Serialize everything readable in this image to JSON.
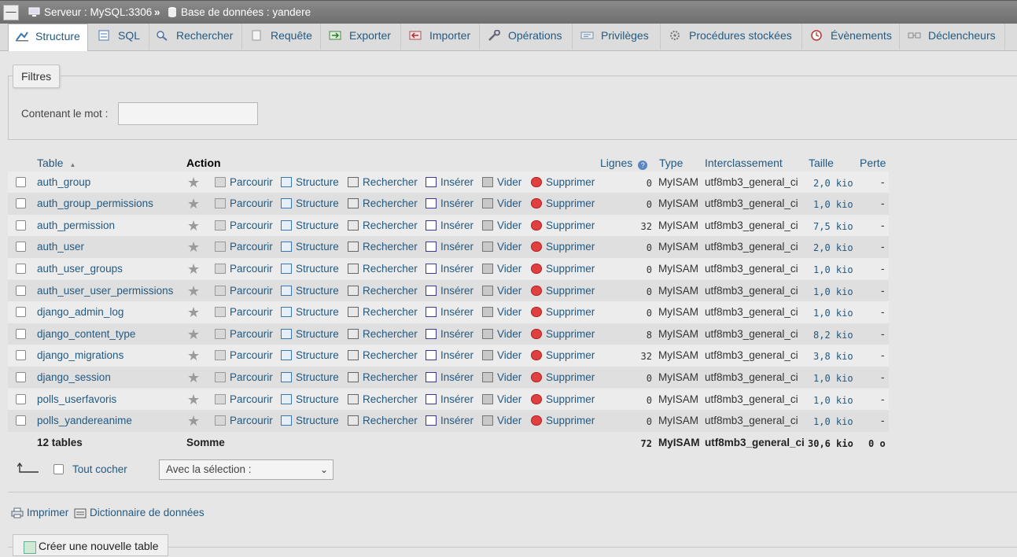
{
  "breadcrumb": {
    "server": "Serveur : MySQL:3306",
    "separator": "»",
    "database": "Base de données : yandere"
  },
  "tabs": [
    {
      "label": "Structure",
      "icon": "structure-icon",
      "active": true
    },
    {
      "label": "SQL",
      "icon": "sql-icon"
    },
    {
      "label": "Rechercher",
      "icon": "search-icon"
    },
    {
      "label": "Requête",
      "icon": "query-icon"
    },
    {
      "label": "Exporter",
      "icon": "export-icon"
    },
    {
      "label": "Importer",
      "icon": "import-icon"
    },
    {
      "label": "Opérations",
      "icon": "wrench-icon"
    },
    {
      "label": "Privilèges",
      "icon": "privileges-icon"
    },
    {
      "label": "Procédures stockées",
      "icon": "routines-icon"
    },
    {
      "label": "Évènements",
      "icon": "clock-icon"
    },
    {
      "label": "Déclencheurs",
      "icon": "triggers-icon"
    }
  ],
  "filters": {
    "legend": "Filtres",
    "label": "Contenant le mot :",
    "value": ""
  },
  "table": {
    "headers": {
      "table": "Table",
      "action": "Action",
      "rows": "Lignes",
      "type": "Type",
      "collation": "Interclassement",
      "size": "Taille",
      "overhead": "Perte"
    },
    "actions": {
      "browse": "Parcourir",
      "structure": "Structure",
      "search": "Rechercher",
      "insert": "Insérer",
      "empty": "Vider",
      "drop": "Supprimer"
    },
    "rows": [
      {
        "name": "auth_group",
        "rows": "0",
        "type": "MyISAM",
        "collation": "utf8mb3_general_ci",
        "size": "2,0 kio",
        "overhead": "-"
      },
      {
        "name": "auth_group_permissions",
        "rows": "0",
        "type": "MyISAM",
        "collation": "utf8mb3_general_ci",
        "size": "1,0 kio",
        "overhead": "-"
      },
      {
        "name": "auth_permission",
        "rows": "32",
        "type": "MyISAM",
        "collation": "utf8mb3_general_ci",
        "size": "7,5 kio",
        "overhead": "-"
      },
      {
        "name": "auth_user",
        "rows": "0",
        "type": "MyISAM",
        "collation": "utf8mb3_general_ci",
        "size": "2,0 kio",
        "overhead": "-"
      },
      {
        "name": "auth_user_groups",
        "rows": "0",
        "type": "MyISAM",
        "collation": "utf8mb3_general_ci",
        "size": "1,0 kio",
        "overhead": "-"
      },
      {
        "name": "auth_user_user_permissions",
        "rows": "0",
        "type": "MyISAM",
        "collation": "utf8mb3_general_ci",
        "size": "1,0 kio",
        "overhead": "-"
      },
      {
        "name": "django_admin_log",
        "rows": "0",
        "type": "MyISAM",
        "collation": "utf8mb3_general_ci",
        "size": "1,0 kio",
        "overhead": "-"
      },
      {
        "name": "django_content_type",
        "rows": "8",
        "type": "MyISAM",
        "collation": "utf8mb3_general_ci",
        "size": "8,2 kio",
        "overhead": "-"
      },
      {
        "name": "django_migrations",
        "rows": "32",
        "type": "MyISAM",
        "collation": "utf8mb3_general_ci",
        "size": "3,8 kio",
        "overhead": "-"
      },
      {
        "name": "django_session",
        "rows": "0",
        "type": "MyISAM",
        "collation": "utf8mb3_general_ci",
        "size": "1,0 kio",
        "overhead": "-"
      },
      {
        "name": "polls_userfavoris",
        "rows": "0",
        "type": "MyISAM",
        "collation": "utf8mb3_general_ci",
        "size": "1,0 kio",
        "overhead": "-"
      },
      {
        "name": "polls_yandereanime",
        "rows": "0",
        "type": "MyISAM",
        "collation": "utf8mb3_general_ci",
        "size": "1,0 kio",
        "overhead": "-"
      }
    ],
    "footer": {
      "count": "12 tables",
      "sum": "Somme",
      "rows": "72",
      "type": "MyISAM",
      "collation": "utf8mb3_general_ci",
      "size": "30,6 kio",
      "overhead": "0 o"
    }
  },
  "bulk": {
    "check_all": "Tout cocher",
    "select_value": "Avec la sélection :"
  },
  "links": {
    "print": "Imprimer",
    "dictionary": "Dictionnaire de données"
  },
  "create_table": "Créer une nouvelle table"
}
